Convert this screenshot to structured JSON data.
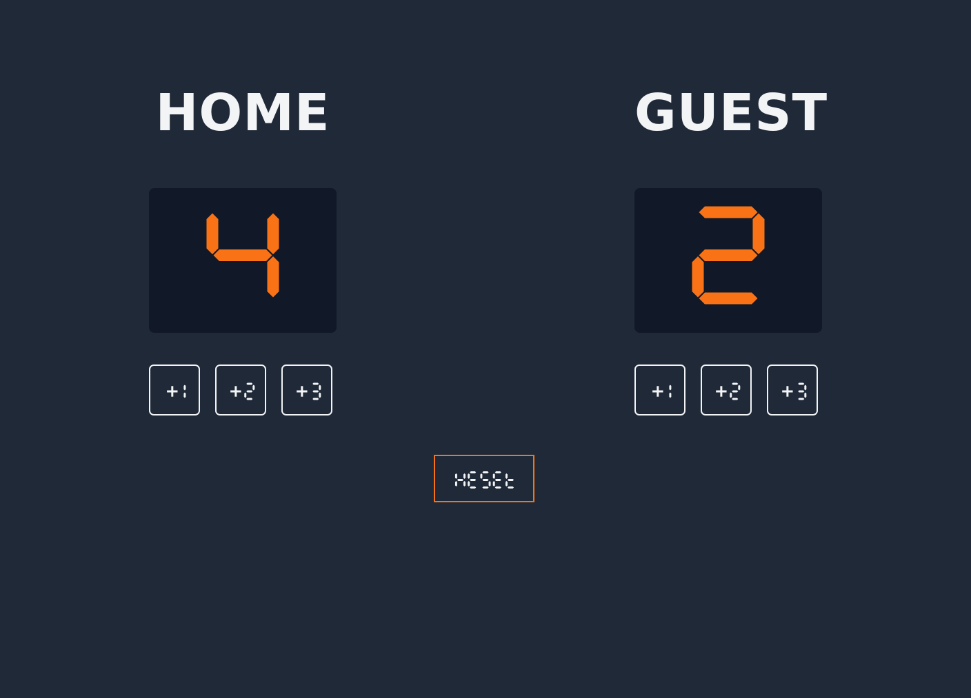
{
  "colors": {
    "background": "#1f2937",
    "score_panel": "#111827",
    "segment_on": "#f97316",
    "text": "#f3f4f6",
    "reset_border": "#f97316"
  },
  "home": {
    "name": "HOME",
    "score": "4",
    "buttons": [
      "+1",
      "+2",
      "+3"
    ]
  },
  "guest": {
    "name": "GUEST",
    "score": "2",
    "buttons": [
      "+1",
      "+2",
      "+3"
    ]
  },
  "reset": {
    "label": "RESET"
  }
}
